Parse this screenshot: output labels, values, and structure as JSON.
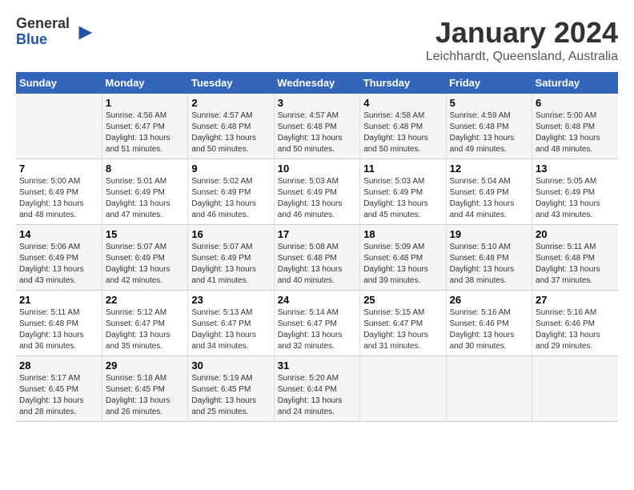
{
  "logo": {
    "general": "General",
    "blue": "Blue"
  },
  "title": "January 2024",
  "subtitle": "Leichhardt, Queensland, Australia",
  "days_header": [
    "Sunday",
    "Monday",
    "Tuesday",
    "Wednesday",
    "Thursday",
    "Friday",
    "Saturday"
  ],
  "weeks": [
    [
      {
        "num": "",
        "detail": ""
      },
      {
        "num": "1",
        "detail": "Sunrise: 4:56 AM\nSunset: 6:47 PM\nDaylight: 13 hours\nand 51 minutes."
      },
      {
        "num": "2",
        "detail": "Sunrise: 4:57 AM\nSunset: 6:48 PM\nDaylight: 13 hours\nand 50 minutes."
      },
      {
        "num": "3",
        "detail": "Sunrise: 4:57 AM\nSunset: 6:48 PM\nDaylight: 13 hours\nand 50 minutes."
      },
      {
        "num": "4",
        "detail": "Sunrise: 4:58 AM\nSunset: 6:48 PM\nDaylight: 13 hours\nand 50 minutes."
      },
      {
        "num": "5",
        "detail": "Sunrise: 4:59 AM\nSunset: 6:48 PM\nDaylight: 13 hours\nand 49 minutes."
      },
      {
        "num": "6",
        "detail": "Sunrise: 5:00 AM\nSunset: 6:48 PM\nDaylight: 13 hours\nand 48 minutes."
      }
    ],
    [
      {
        "num": "7",
        "detail": "Sunrise: 5:00 AM\nSunset: 6:49 PM\nDaylight: 13 hours\nand 48 minutes."
      },
      {
        "num": "8",
        "detail": "Sunrise: 5:01 AM\nSunset: 6:49 PM\nDaylight: 13 hours\nand 47 minutes."
      },
      {
        "num": "9",
        "detail": "Sunrise: 5:02 AM\nSunset: 6:49 PM\nDaylight: 13 hours\nand 46 minutes."
      },
      {
        "num": "10",
        "detail": "Sunrise: 5:03 AM\nSunset: 6:49 PM\nDaylight: 13 hours\nand 46 minutes."
      },
      {
        "num": "11",
        "detail": "Sunrise: 5:03 AM\nSunset: 6:49 PM\nDaylight: 13 hours\nand 45 minutes."
      },
      {
        "num": "12",
        "detail": "Sunrise: 5:04 AM\nSunset: 6:49 PM\nDaylight: 13 hours\nand 44 minutes."
      },
      {
        "num": "13",
        "detail": "Sunrise: 5:05 AM\nSunset: 6:49 PM\nDaylight: 13 hours\nand 43 minutes."
      }
    ],
    [
      {
        "num": "14",
        "detail": "Sunrise: 5:06 AM\nSunset: 6:49 PM\nDaylight: 13 hours\nand 43 minutes."
      },
      {
        "num": "15",
        "detail": "Sunrise: 5:07 AM\nSunset: 6:49 PM\nDaylight: 13 hours\nand 42 minutes."
      },
      {
        "num": "16",
        "detail": "Sunrise: 5:07 AM\nSunset: 6:49 PM\nDaylight: 13 hours\nand 41 minutes."
      },
      {
        "num": "17",
        "detail": "Sunrise: 5:08 AM\nSunset: 6:48 PM\nDaylight: 13 hours\nand 40 minutes."
      },
      {
        "num": "18",
        "detail": "Sunrise: 5:09 AM\nSunset: 6:48 PM\nDaylight: 13 hours\nand 39 minutes."
      },
      {
        "num": "19",
        "detail": "Sunrise: 5:10 AM\nSunset: 6:48 PM\nDaylight: 13 hours\nand 38 minutes."
      },
      {
        "num": "20",
        "detail": "Sunrise: 5:11 AM\nSunset: 6:48 PM\nDaylight: 13 hours\nand 37 minutes."
      }
    ],
    [
      {
        "num": "21",
        "detail": "Sunrise: 5:11 AM\nSunset: 6:48 PM\nDaylight: 13 hours\nand 36 minutes."
      },
      {
        "num": "22",
        "detail": "Sunrise: 5:12 AM\nSunset: 6:47 PM\nDaylight: 13 hours\nand 35 minutes."
      },
      {
        "num": "23",
        "detail": "Sunrise: 5:13 AM\nSunset: 6:47 PM\nDaylight: 13 hours\nand 34 minutes."
      },
      {
        "num": "24",
        "detail": "Sunrise: 5:14 AM\nSunset: 6:47 PM\nDaylight: 13 hours\nand 32 minutes."
      },
      {
        "num": "25",
        "detail": "Sunrise: 5:15 AM\nSunset: 6:47 PM\nDaylight: 13 hours\nand 31 minutes."
      },
      {
        "num": "26",
        "detail": "Sunrise: 5:16 AM\nSunset: 6:46 PM\nDaylight: 13 hours\nand 30 minutes."
      },
      {
        "num": "27",
        "detail": "Sunrise: 5:16 AM\nSunset: 6:46 PM\nDaylight: 13 hours\nand 29 minutes."
      }
    ],
    [
      {
        "num": "28",
        "detail": "Sunrise: 5:17 AM\nSunset: 6:45 PM\nDaylight: 13 hours\nand 28 minutes."
      },
      {
        "num": "29",
        "detail": "Sunrise: 5:18 AM\nSunset: 6:45 PM\nDaylight: 13 hours\nand 26 minutes."
      },
      {
        "num": "30",
        "detail": "Sunrise: 5:19 AM\nSunset: 6:45 PM\nDaylight: 13 hours\nand 25 minutes."
      },
      {
        "num": "31",
        "detail": "Sunrise: 5:20 AM\nSunset: 6:44 PM\nDaylight: 13 hours\nand 24 minutes."
      },
      {
        "num": "",
        "detail": ""
      },
      {
        "num": "",
        "detail": ""
      },
      {
        "num": "",
        "detail": ""
      }
    ]
  ]
}
